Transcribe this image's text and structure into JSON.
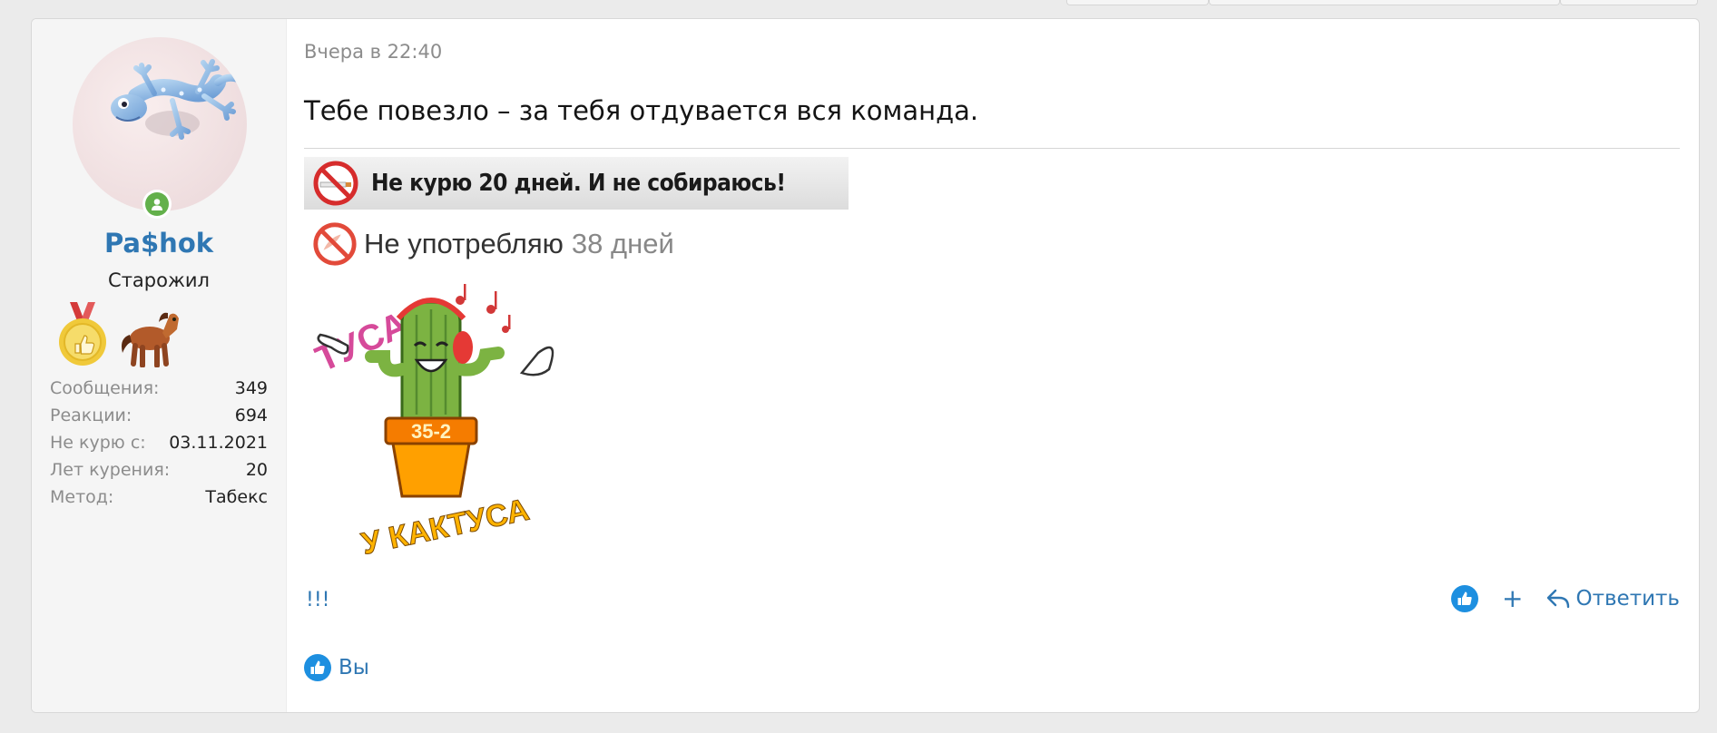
{
  "post": {
    "user": {
      "name": "Pa$hok",
      "title": "Старожил",
      "online": true,
      "stats": [
        {
          "label": "Сообщения:",
          "value": "349"
        },
        {
          "label": "Реакции:",
          "value": "694"
        },
        {
          "label": "Не курю с:",
          "value": "03.11.2021"
        },
        {
          "label": "Лет курения:",
          "value": "20"
        },
        {
          "label": "Метод:",
          "value": "Табекс"
        }
      ],
      "trophy_icons": [
        "medal-thumbs-up-icon",
        "pony-icon"
      ]
    },
    "date": "Вчера в 22:40",
    "text": "Тебе повезло – за тебя отдувается вся команда."
  },
  "signature": {
    "banner1_text": "Не курю 20 дней. И не собираюсь!",
    "banner2_label": "Не употребляю",
    "banner2_count": "38 дней",
    "cactus_top": "ТУСА",
    "cactus_pot": "35-2",
    "cactus_bottom": "У КАКТУСА",
    "extra": "!!!"
  },
  "actions": {
    "like_icon": "thumbs-up-icon",
    "plus_label": "+",
    "reply_label": "Ответить"
  },
  "reactions": {
    "icon": "thumbs-up-icon",
    "users_label": "Вы"
  },
  "colors": {
    "accent": "#2f77b3",
    "like": "#1d8fe0",
    "online": "#63b04b",
    "sidebar_bg": "#f5f5f5",
    "page_bg": "#ebebeb"
  }
}
